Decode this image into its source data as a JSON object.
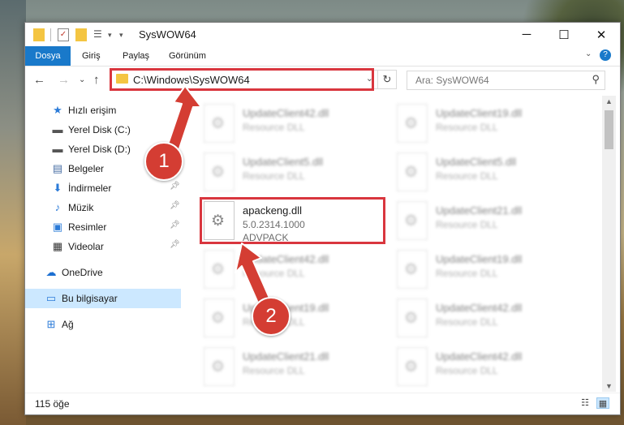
{
  "window": {
    "title": "SysWOW64"
  },
  "ribbon": {
    "tabs": [
      "Dosya",
      "Giriş",
      "Paylaş",
      "Görünüm"
    ]
  },
  "address": {
    "path": "C:\\Windows\\SysWOW64"
  },
  "search": {
    "placeholder": "Ara: SysWOW64"
  },
  "sidebar": {
    "items": [
      {
        "label": "Hızlı erişim",
        "icon": "star-icon",
        "pinned": false
      },
      {
        "label": "Yerel Disk (C:)",
        "icon": "drive-icon",
        "pinned": false
      },
      {
        "label": "Yerel Disk (D:)",
        "icon": "drive-icon",
        "pinned": false
      },
      {
        "label": "Belgeler",
        "icon": "documents-icon",
        "pinned": true
      },
      {
        "label": "İndirmeler",
        "icon": "download-icon",
        "pinned": true
      },
      {
        "label": "Müzik",
        "icon": "music-icon",
        "pinned": true
      },
      {
        "label": "Resimler",
        "icon": "pictures-icon",
        "pinned": true
      },
      {
        "label": "Videolar",
        "icon": "video-icon",
        "pinned": true
      },
      {
        "label": "OneDrive",
        "icon": "cloud-icon",
        "pinned": false
      },
      {
        "label": "Bu bilgisayar",
        "icon": "computer-icon",
        "pinned": false,
        "selected": true
      },
      {
        "label": "Ağ",
        "icon": "network-icon",
        "pinned": false
      }
    ]
  },
  "files": {
    "left": [
      {
        "name": "UpdateClient42.dll",
        "line2": "Resource DLL",
        "line3": ""
      },
      {
        "name": "UpdateClient5.dll",
        "line2": "Resource DLL",
        "line3": ""
      },
      {
        "name": "apackeng.dll",
        "line2": "5.0.2314.1000",
        "line3": "ADVPACK",
        "highlighted": true
      },
      {
        "name": "UpdateClient42.dll",
        "line2": "Resource DLL",
        "line3": ""
      },
      {
        "name": "UpdateClient19.dll",
        "line2": "Resource DLL",
        "line3": ""
      },
      {
        "name": "UpdateClient21.dll",
        "line2": "Resource DLL",
        "line3": ""
      }
    ],
    "right": [
      {
        "name": "UpdateClient19.dll",
        "line2": "Resource DLL"
      },
      {
        "name": "UpdateClient5.dll",
        "line2": "Resource DLL"
      },
      {
        "name": "UpdateClient21.dll",
        "line2": "Resource DLL"
      },
      {
        "name": "UpdateClient19.dll",
        "line2": "Resource DLL"
      },
      {
        "name": "UpdateClient42.dll",
        "line2": "Resource DLL"
      },
      {
        "name": "UpdateClient42.dll",
        "line2": "Resource DLL"
      }
    ]
  },
  "status": {
    "count": "115 öğe"
  },
  "annotations": {
    "badge1": "1",
    "badge2": "2"
  },
  "colors": {
    "accent": "#1979ca",
    "highlight": "#d9363e",
    "badge": "#d43d33",
    "selected": "#cce8ff"
  }
}
